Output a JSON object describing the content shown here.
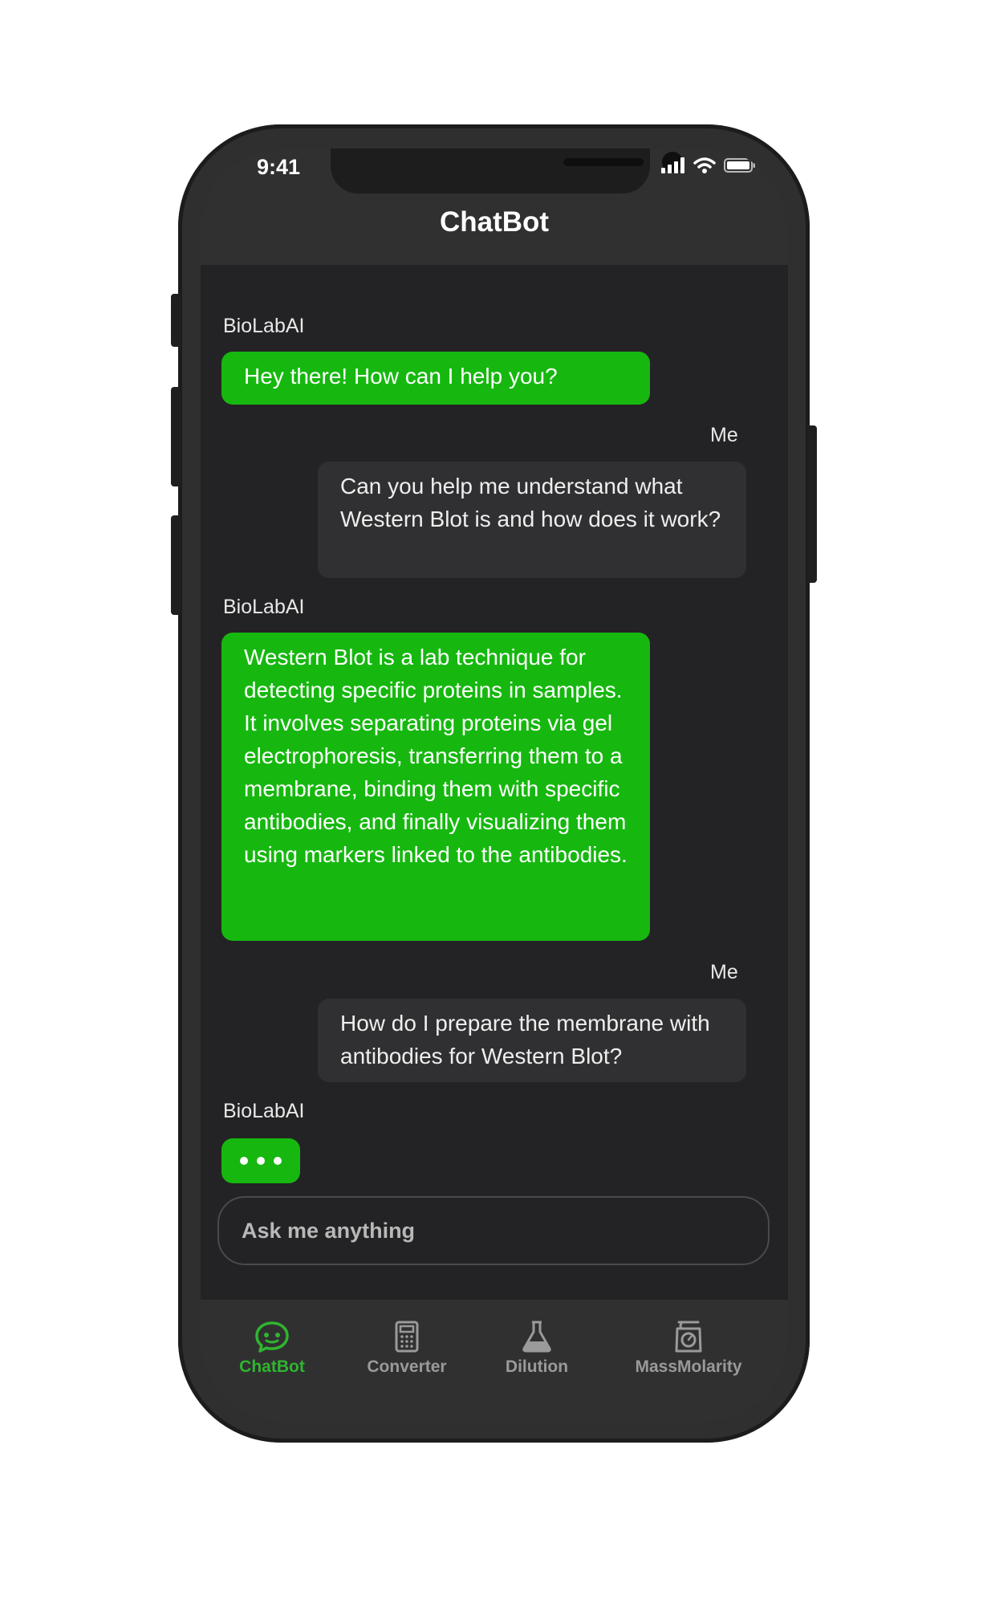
{
  "status_bar": {
    "time": "9:41"
  },
  "header": {
    "title": "ChatBot"
  },
  "messages": [
    {
      "sender": "BioLabAI",
      "text": "Hey there! How can I help you?",
      "role": "bot"
    },
    {
      "sender": "Me",
      "text": "Can you help me understand what Western Blot is and how does it work?",
      "role": "me"
    },
    {
      "sender": "BioLabAI",
      "text": "Western Blot is a lab technique for detecting specific proteins in samples. It involves separating proteins via gel electrophoresis, transferring them to a membrane, binding them with specific antibodies, and finally visualizing them using markers linked to the antibodies.",
      "role": "bot"
    },
    {
      "sender": "Me",
      "text": "How do I prepare the membrane with antibodies for Western Blot?",
      "role": "me"
    },
    {
      "sender": "BioLabAI",
      "text": "",
      "role": "bot-typing"
    }
  ],
  "input": {
    "placeholder": "Ask me anything"
  },
  "tabs": [
    {
      "label": "ChatBot",
      "icon": "chat-bubble-icon",
      "active": true
    },
    {
      "label": "Converter",
      "icon": "calculator-icon",
      "active": false
    },
    {
      "label": "Dilution",
      "icon": "flask-icon",
      "active": false
    },
    {
      "label": "MassMolarity",
      "icon": "scale-icon",
      "active": false
    }
  ],
  "colors": {
    "bot_bubble": "#16b80f",
    "user_bubble": "#303032",
    "active_tab": "#2fb52f",
    "background": "#232325"
  }
}
